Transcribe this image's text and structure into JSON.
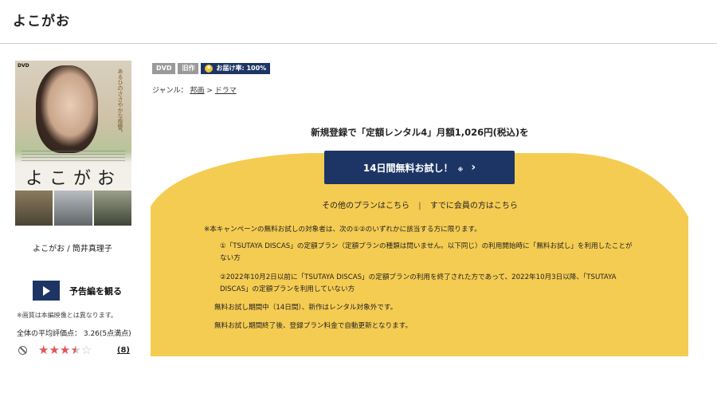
{
  "page": {
    "title": "よこがお"
  },
  "poster": {
    "dvd_tag": "DVD",
    "tagline": "あるひのささやかな復讐。",
    "title_art": "よこがお",
    "caption": "よこがお / 筒井真理子"
  },
  "trailer": {
    "label": "予告編を観る"
  },
  "note": "※画質は本編映像とは異なります。",
  "rating": {
    "text": "全体の平均評価点： 3.26(5点満点)",
    "value": 3.26,
    "max": 5,
    "count": "(8)",
    "star_color": "#e0555a"
  },
  "badges": {
    "format": "DVD",
    "old": "旧作",
    "delivery": "お届け率: 100%"
  },
  "genre": {
    "label": "ジャンル：",
    "parent": "邦画",
    "sep": ">",
    "child": "ドラマ"
  },
  "campaign": {
    "title": "新規登録で「定額レンタル4」月額1,026円(税込)を",
    "cta_label": "14日間無料お試し！",
    "cta_mark": "※",
    "other_plans": "その他のプランはこちら",
    "divider": "|",
    "members": "すでに会員の方はこちら",
    "yellow": "#f5cc52",
    "navy": "#1c3564",
    "conditions": [
      "※本キャンペーンの無料お試しの対象者は、次の①②のいずれかに該当する方に限ります。",
      "①「TSUTAYA DISCAS」の定額プラン（定額プランの種類は問いません。以下同じ）の利用開始時に「無料お試し」を利用したことがない方",
      "②2022年10月2日以前に「TSUTAYA DISCAS」の定額プランの利用を終了された方であって、2022年10月3日以降、「TSUTAYA DISCAS」の定額プランを利用していない方",
      "無料お試し期間中（14日間）、新作はレンタル対象外です。",
      "無料お試し期間終了後、登録プラン料金で自動更新となります。"
    ]
  }
}
